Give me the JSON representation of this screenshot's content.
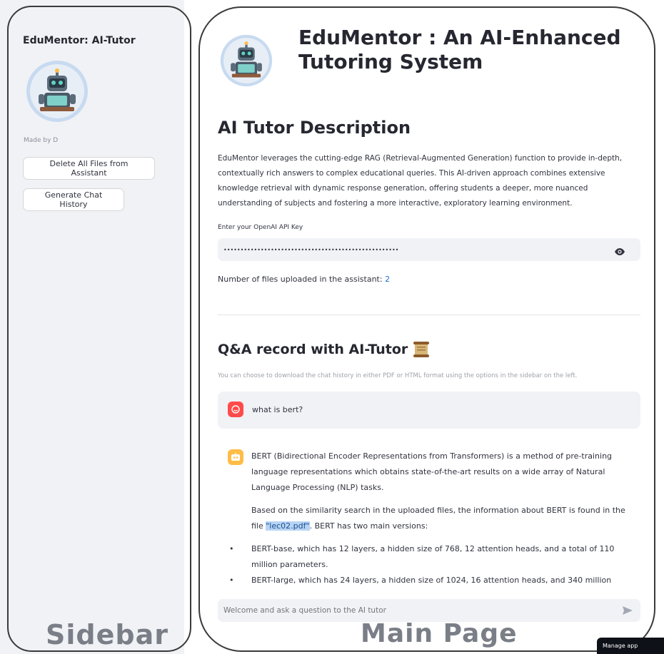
{
  "sidebar": {
    "title": "EduMentor: AI-Tutor",
    "logo_icon": "robot-tutor-icon",
    "made_by": "Made by D",
    "buttons": {
      "delete_files": "Delete All Files from Assistant",
      "generate_history": "Generate Chat History"
    },
    "caption": "Sidebar"
  },
  "main": {
    "logo_icon": "robot-tutor-icon",
    "title": "EduMentor : An AI-Enhanced Tutoring System",
    "description_heading": "AI Tutor Description",
    "description": "EduMentor leverages the cutting-edge RAG (Retrieval-Augmented Generation) function to provide in-depth, contextually rich answers to complex educational queries. This AI-driven approach combines extensive knowledge retrieval with dynamic response generation, offering students a deeper, more nuanced understanding of subjects and fostering a more interactive, exploratory learning environment.",
    "api_key": {
      "label": "Enter your OpenAI API Key",
      "value": "••••••••••••••••••••••••••••••••••••••••••••••••••••",
      "toggle_icon": "eye-icon"
    },
    "files_uploaded": {
      "label": "Number of files uploaded in the assistant: ",
      "count": "2"
    },
    "qa_heading": "Q&A record with AI-Tutor",
    "qa_heading_icon": "scroll-icon",
    "qa_note": "You can choose to download the chat history in either PDF or HTML format using the options in the sidebar on the left.",
    "chat": {
      "user_message": "what is bert?",
      "bot_para1": "BERT (Bidirectional Encoder Representations from Transformers) is a method of pre-training language representations which obtains state-of-the-art results on a wide array of Natural Language Processing (NLP) tasks.",
      "bot_para2_before": "Based on the similarity search in the uploaded files, the information about BERT is found in the file ",
      "bot_para2_file": "\"lec02.pdf\"",
      "bot_para2_after": ". BERT has two main versions:",
      "bullets": [
        "BERT-base, which has 12 layers, a hidden size of 768, 12 attention heads, and a total of 110 million parameters.",
        "BERT-large, which has 24 layers, a hidden size of 1024, 16 attention heads, and 340 million"
      ]
    },
    "chat_input_placeholder": "Welcome and ask a question to the AI tutor",
    "caption": "Main Page"
  },
  "manage_app": "Manage app",
  "colors": {
    "sidebar_bg": "#f0f2f6",
    "user_avatar": "#ff4b4b",
    "bot_avatar": "#ffbd45",
    "link_blue": "#1c6fd0",
    "highlight": "#b8d4f4"
  }
}
